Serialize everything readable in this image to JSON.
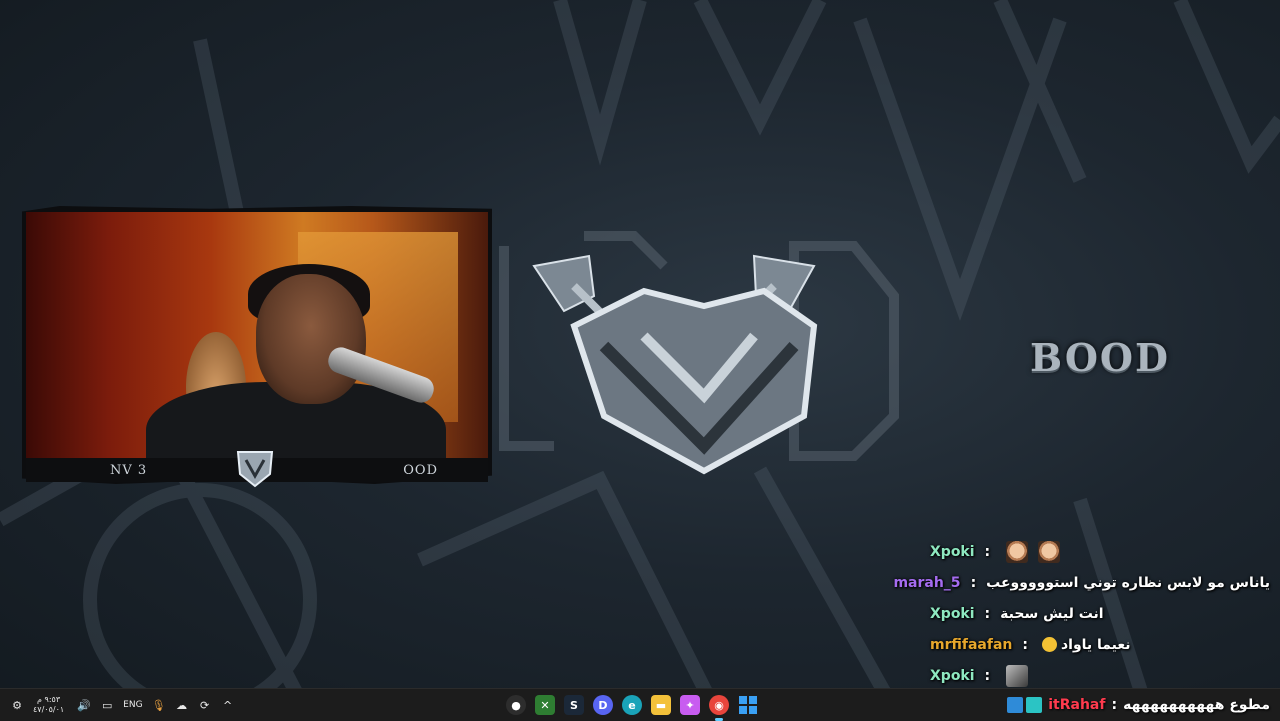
{
  "overlay": {
    "brand_text": "BOOD",
    "cam_bar_left": "NV 3",
    "cam_bar_right": "OOD"
  },
  "chat": {
    "messages": [
      {
        "user": "Xpoki",
        "user_color": "#8ee8c0",
        "text": "",
        "emotes": [
          "face-emote",
          "face-emote"
        ]
      },
      {
        "user": "marah_5",
        "user_color": "#a56cf0",
        "text": "ياناس مو لابس نظاره توني استوووووعب",
        "emotes": []
      },
      {
        "user": "Xpoki",
        "user_color": "#8ee8c0",
        "text": "انت ليش سحبة",
        "emotes": []
      },
      {
        "user": "mrfifaafan",
        "user_color": "#e7a72c",
        "text": "نعيما ياواد",
        "emotes": [
          "smile-emoji"
        ]
      },
      {
        "user": "Xpoki",
        "user_color": "#8ee8c0",
        "text": "",
        "emotes": [
          "image-emote"
        ]
      }
    ],
    "last_message": {
      "user": "itRahaf",
      "user_color": "#ff3b4e",
      "text": "مطوع ههههههههههه"
    }
  },
  "taskbar": {
    "language": "ENG",
    "clock_time": "٩:٥٣ م",
    "clock_date": "٤٧/٠٥/٠١",
    "apps": [
      {
        "name": "obs-icon",
        "color": "#2d2d2d",
        "glyph": "●"
      },
      {
        "name": "xbox-icon",
        "color": "#2e7d32",
        "glyph": "✕"
      },
      {
        "name": "steam-icon",
        "color": "#1b2838",
        "glyph": "S"
      },
      {
        "name": "discord-icon",
        "color": "#5865f2",
        "glyph": "D"
      },
      {
        "name": "edge-icon",
        "color": "#1aa3b8",
        "glyph": "e"
      },
      {
        "name": "file-explorer-icon",
        "color": "#f3c13a",
        "glyph": "▬"
      },
      {
        "name": "copilot-icon",
        "color": "#c85cf0",
        "glyph": "✦"
      },
      {
        "name": "chrome-icon",
        "color": "#e8453c",
        "glyph": "◉"
      },
      {
        "name": "start-icon",
        "color": "",
        "glyph": ""
      }
    ]
  }
}
